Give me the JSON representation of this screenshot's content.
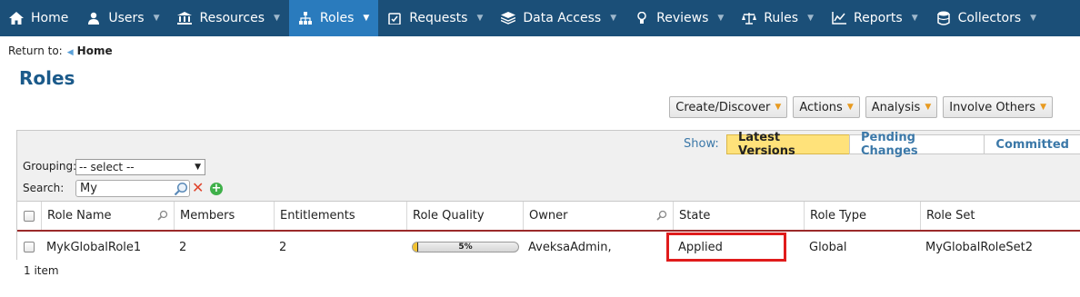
{
  "nav": {
    "items": [
      {
        "label": "Home",
        "icon": "home-icon",
        "active": false
      },
      {
        "label": "Users",
        "icon": "users-icon",
        "active": false
      },
      {
        "label": "Resources",
        "icon": "resources-icon",
        "active": false
      },
      {
        "label": "Roles",
        "icon": "roles-icon",
        "active": true
      },
      {
        "label": "Requests",
        "icon": "requests-icon",
        "active": false
      },
      {
        "label": "Data Access",
        "icon": "data-access-icon",
        "active": false
      },
      {
        "label": "Reviews",
        "icon": "reviews-icon",
        "active": false
      },
      {
        "label": "Rules",
        "icon": "rules-icon",
        "active": false
      },
      {
        "label": "Reports",
        "icon": "reports-icon",
        "active": false
      },
      {
        "label": "Collectors",
        "icon": "collectors-icon",
        "active": false
      }
    ]
  },
  "breadcrumb": {
    "prefix": "Return to:",
    "link": "Home"
  },
  "page": {
    "title": "Roles"
  },
  "actions": {
    "create": "Create/Discover",
    "actions": "Actions",
    "analysis": "Analysis",
    "involve": "Involve Others"
  },
  "view": {
    "show_label": "Show:",
    "tabs": [
      "Latest Versions",
      "Pending Changes",
      "Committed"
    ],
    "active_tab": "Latest Versions"
  },
  "filters": {
    "grouping_label": "Grouping:",
    "grouping_value": "-- select --",
    "search_label": "Search:",
    "search_value": "My"
  },
  "table": {
    "columns": [
      "Role Name",
      "Members",
      "Entitlements",
      "Role Quality",
      "Owner",
      "State",
      "Role Type",
      "Role Set"
    ],
    "rows": [
      {
        "role_name": "MykGlobalRole1",
        "members": "2",
        "entitlements": "2",
        "role_quality_text": "5%",
        "role_quality": 0.05,
        "owner": "AveksaAdmin,",
        "state": "Applied",
        "role_type": "Global",
        "role_set": "MyGlobalRoleSet2"
      }
    ],
    "count_text": "1 item"
  },
  "colors": {
    "nav_bg": "#1b4f78",
    "nav_active": "#2a7bbd",
    "title": "#1b5a8a",
    "highlight": "#e01b1b",
    "active_tab": "#ffe27a",
    "quality_fill": "#f2c230"
  }
}
